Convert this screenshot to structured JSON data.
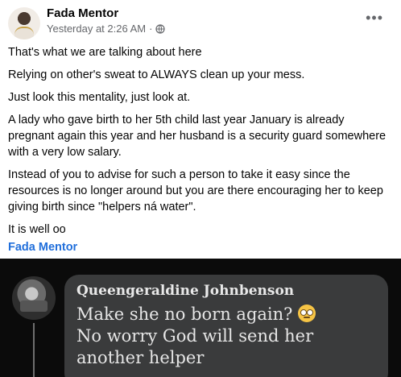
{
  "post": {
    "author": "Fada Mentor",
    "timestamp": "Yesterday at 2:26 AM",
    "separator": "·",
    "more_icon": "•••",
    "paragraphs": [
      "That's what we are talking about here",
      "Relying on other's sweat to ALWAYS clean up your mess.",
      "Just look this mentality, just look at.",
      "A lady who gave birth to her 5th child last year January is already pregnant again this year and her husband is a security guard somewhere with a very low salary.",
      "Instead of you to advise for such a person to take it easy since the resources is no longer around but you are there encouraging her to keep giving birth since \"helpers ná water\".",
      "It is well oo"
    ],
    "signature": "Fada Mentor"
  },
  "comment": {
    "author": "Queengeraldine Johnbenson",
    "line1": "Make she no born again?",
    "emoji": "eye-roll-emoji",
    "line2": "No worry God will send her another helper"
  }
}
